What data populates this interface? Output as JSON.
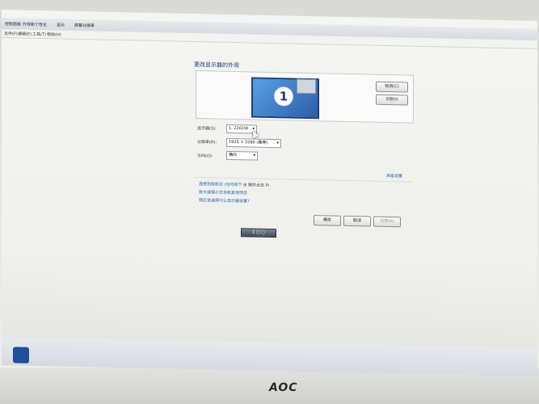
{
  "breadcrumb": [
    "控制面板",
    "外观和个性化",
    "显示",
    "屏幕分辨率"
  ],
  "menu": [
    "文件(F)",
    "编辑(E)",
    "工具(T)",
    "帮助(H)"
  ],
  "page_title": "更改显示器的外观",
  "monitor_number": "1",
  "buttons": {
    "detect": "检测(C)",
    "identify": "识别(I)",
    "ok": "确定",
    "cancel": "取消",
    "apply": "应用(A)"
  },
  "labels": {
    "display": "显示器(S):",
    "resolution": "分辨率(R):",
    "orientation": "方向(O):"
  },
  "fields": {
    "display": "1. 2261W",
    "resolution": "1920 × 1080 (推荐)",
    "orientation": "横向"
  },
  "advanced_link": "高级设置",
  "projector_hint": {
    "prefix": "连接到投影仪 (也可按下",
    "suffix": "键并点击 P)"
  },
  "links": [
    "放大或缩小文本和其他项目",
    "我应该选择什么显示器设置?"
  ],
  "taskbar_item": "1 ▢ ▢",
  "brand": "AOC"
}
